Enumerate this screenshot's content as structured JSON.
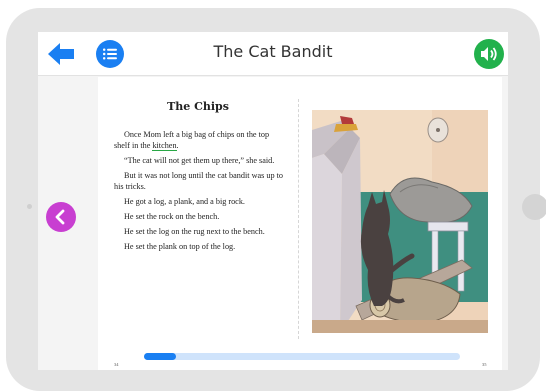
{
  "header": {
    "title": "The Cat Bandit",
    "back_icon": "arrow-left-icon",
    "menu_icon": "list-icon",
    "sound_icon": "speaker-icon"
  },
  "navigation": {
    "prev_icon": "chevron-left-icon"
  },
  "story": {
    "title": "The Chips",
    "paragraphs": [
      {
        "before": "Once Mom left a big bag of chips on the top shelf in the ",
        "vocab": "kitchen",
        "after": "."
      },
      {
        "before": "“The cat will not get them up there,” she said.",
        "vocab": "",
        "after": ""
      },
      {
        "before": "But it was not long until the cat bandit was up to his tricks.",
        "vocab": "",
        "after": ""
      },
      {
        "before": "He got a log, a plank, and a big rock.",
        "vocab": "",
        "after": ""
      },
      {
        "before": "He set the rock on the bench.",
        "vocab": "",
        "after": ""
      },
      {
        "before": "He set the log on the rug next to the bench.",
        "vocab": "",
        "after": ""
      },
      {
        "before": "He set the plank on top of the log.",
        "vocab": "",
        "after": ""
      }
    ]
  },
  "footer": {
    "left_page": "34",
    "right_page": "35",
    "progress": 0.1
  },
  "colors": {
    "back": "#1a7ff2",
    "menu": "#1a7ff2",
    "sound": "#22b14c",
    "prev": "#c83fd1",
    "vocab_underline": "#28a745",
    "progress_fill": "#1a7ff2",
    "progress_track": "#cfe3fb"
  }
}
